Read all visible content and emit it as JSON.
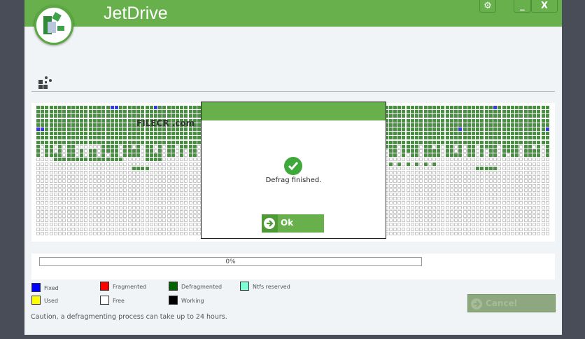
{
  "app": {
    "title": "JetDrive"
  },
  "titlebar": {
    "settings_icon": "gear-icon",
    "minimize_label": "_",
    "close_label": "X"
  },
  "dialog": {
    "message": "Defrag finished.",
    "ok_label": "Ok",
    "status_icon": "check-circle-icon"
  },
  "progress": {
    "label": "0%",
    "value": 0
  },
  "legend": [
    {
      "label": "Fixed",
      "color": "#0000ff"
    },
    {
      "label": "Fragmented",
      "color": "#ff0000"
    },
    {
      "label": "Defragmented",
      "color": "#006400"
    },
    {
      "label": "Ntfs reserved",
      "color": "#7fffd4"
    },
    {
      "label": "Used",
      "color": "#ffff00"
    },
    {
      "label": "Free",
      "color": "#ffffff"
    },
    {
      "label": "Working",
      "color": "#000000"
    }
  ],
  "cancel_label": "Cancel",
  "caution": "Caution, a defragmenting process can take up to 24 hours.",
  "watermark": "FILECR .com",
  "colors": {
    "accent": "#67b04b",
    "defrag_cell": "#4a8f44",
    "free_cell": "#ffffff",
    "fixed_cell": "#3a3ae0"
  }
}
